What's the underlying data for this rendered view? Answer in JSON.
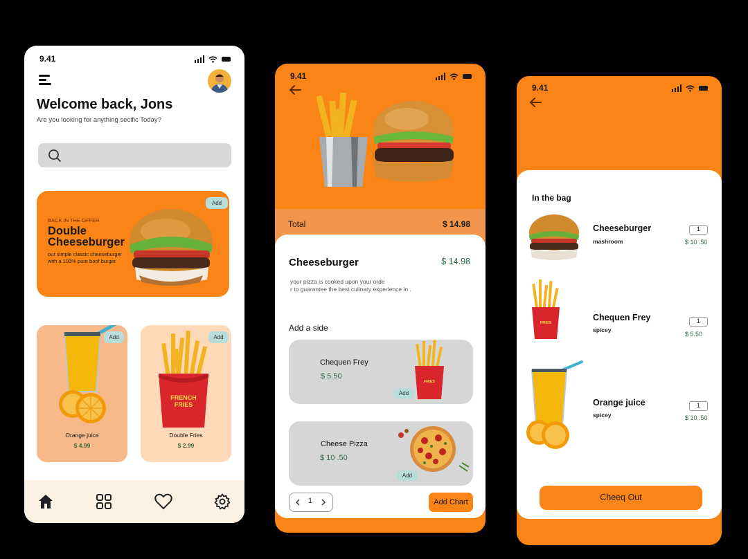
{
  "colors": {
    "accent": "#fa8415",
    "price_green": "#2d6b47",
    "card_peach": "#ffd9b8",
    "juice_card": "#f7b98a"
  },
  "home": {
    "time": "9.41",
    "welcome": "Welcome back, Jons",
    "subtitle": "Are you looking for anything secific Today?",
    "promo": {
      "tag": "BACK IN THE OFFER",
      "title": "Double Cheeseburger",
      "desc": "our simple classic cheeseburger with a 100% pure boof burger",
      "add": "Add"
    },
    "products": [
      {
        "name": "Orange juice",
        "price": "$ 4.99",
        "add": "Add"
      },
      {
        "name": "Double Fries",
        "price": "$ 2.99",
        "add": "Add"
      }
    ],
    "nav": [
      "home-icon",
      "grid-icon",
      "heart-icon",
      "gear-icon"
    ]
  },
  "detail": {
    "time": "9.41",
    "total_label": "Total",
    "total_value": "$ 14.98",
    "title": "Cheeseburger",
    "price": "$ 14.98",
    "desc_line1": "your pizza is cooked upon your orde",
    "desc_line2": "r to guarantee the best culinary experience in .",
    "add_side": "Add a side",
    "sides": [
      {
        "name": "Chequen Frey",
        "price": "$ 5.50",
        "add": "Add"
      },
      {
        "name": "Cheese Pizza",
        "price": "$ 10 .50",
        "add": "Add"
      }
    ],
    "qty": "1",
    "add_chart": "Add Chart"
  },
  "bag": {
    "time": "9.41",
    "title": "In the bag",
    "items": [
      {
        "name": "Cheeseburger",
        "sub": "mashroom",
        "qty": "1",
        "price": "$ 10 .50"
      },
      {
        "name": "Chequen Frey",
        "sub": "spicey",
        "qty": "1",
        "price": "$ 5.50"
      },
      {
        "name": "Orange juice",
        "sub": "spicey",
        "qty": "1",
        "price": "$ 10 .50"
      }
    ],
    "checkout": "Cheeq Out"
  }
}
